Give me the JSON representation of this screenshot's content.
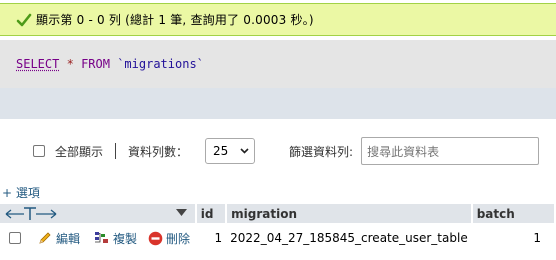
{
  "success": {
    "message": "顯示第 0 - 0 列 (總計 1 筆, 查詢用了 0.0003 秒。)",
    "color": "#ebf8a4"
  },
  "sql": {
    "select": "SELECT",
    "star": "*",
    "from": "FROM",
    "table": "`migrations`"
  },
  "nav": {
    "show_all": "全部顯示",
    "rows_label": "資料列數：",
    "rows_value": "25",
    "filter_label": "篩選資料列:",
    "filter_placeholder": "搜尋此資料表"
  },
  "options_link": "+ 選項",
  "table": {
    "columns": [
      "id",
      "migration",
      "batch"
    ],
    "actions": {
      "edit": "編輯",
      "copy": "複製",
      "delete": "刪除"
    },
    "rows": [
      {
        "id": "1",
        "migration": "2022_04_27_185845_create_user_table",
        "batch": "1"
      }
    ]
  },
  "colors": {
    "link": "#235a81",
    "header_bg": "#e0e4e9",
    "sql_bg": "#e5e5e5"
  }
}
